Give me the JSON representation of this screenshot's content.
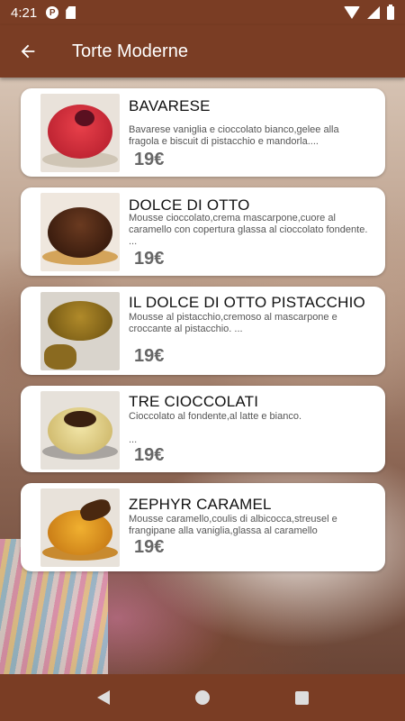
{
  "status_bar": {
    "time": "4:21"
  },
  "app_bar": {
    "title": "Torte Moderne"
  },
  "products": [
    {
      "name": "BAVARESE",
      "description": "Bavarese vaniglia e cioccolato bianco,gelee alla fragola e biscuit di pistacchio e mandorla....",
      "price": "19€"
    },
    {
      "name": "DOLCE DI OTTO",
      "description": "Mousse cioccolato,crema mascarpone,cuore al caramello con copertura glassa al cioccolato fondente. ...",
      "price": "19€"
    },
    {
      "name": "IL DOLCE DI OTTO PISTACCHIO",
      "description": "Mousse al pistacchio,cremoso al mascarpone e croccante al pistacchio. ...",
      "price": "19€"
    },
    {
      "name": "TRE CIOCCOLATI",
      "description": "Cioccolato al fondente,al latte e bianco.",
      "description_more": "...",
      "price": "19€"
    },
    {
      "name": "ZEPHYR CARAMEL",
      "description": "Mousse caramello,coulis di albicocca,streusel e frangipane alla vaniglia,glassa al caramello",
      "price": "19€"
    }
  ],
  "colors": {
    "bar": "#7a3d24",
    "card": "#ffffff"
  }
}
